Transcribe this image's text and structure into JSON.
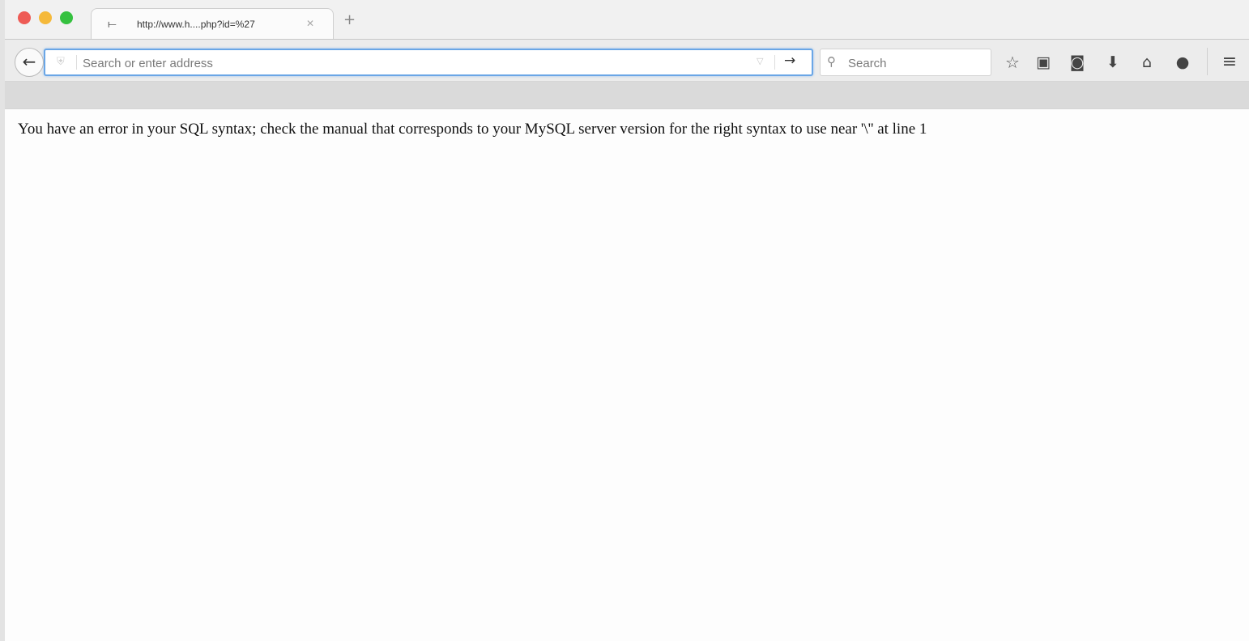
{
  "browser": {
    "tab": {
      "title": "http://www.h....php?id=%27",
      "favicon_icon": "page-icon",
      "close_glyph": "✕"
    },
    "new_tab_glyph": "+",
    "nav": {
      "back_glyph": "←",
      "url_placeholder": "Search or enter address",
      "go_glyph": "→",
      "dropdown_glyph": "▽",
      "search_placeholder": "Search"
    },
    "toolbar": {
      "star_glyph": "☆",
      "reading_glyph": "▣",
      "pocket_glyph": "◙",
      "download_glyph": "⬇",
      "home_glyph": "⌂",
      "chat_glyph": "●",
      "menu_glyph": "≡"
    }
  },
  "page": {
    "error_message": "You have an error in your SQL syntax; check the manual that corresponds to your MySQL server version for the right syntax to use near '\\'' at line 1"
  },
  "colors": {
    "traffic_red": "#ee5b55",
    "traffic_yellow": "#f5b93a",
    "traffic_green": "#35c13f",
    "url_focus": "#6aa6e6"
  }
}
